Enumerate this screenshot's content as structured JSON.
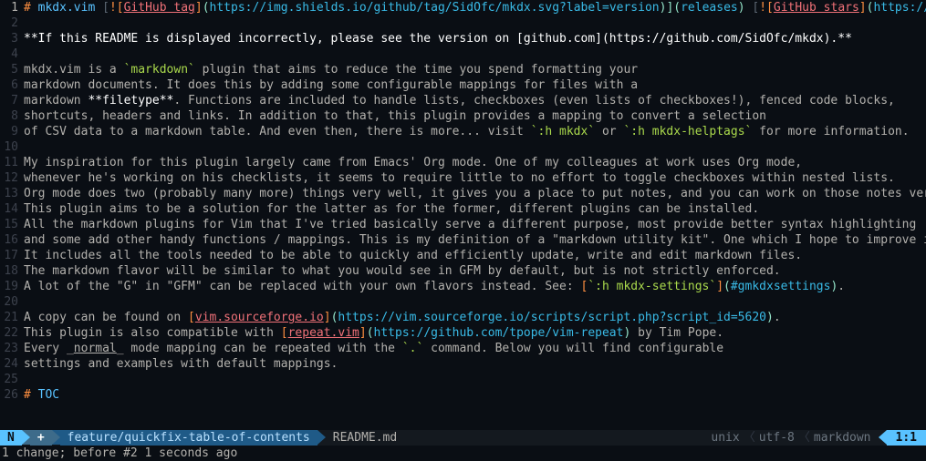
{
  "lines": [
    {
      "n": "1",
      "current": true,
      "segs": [
        {
          "t": "# ",
          "c": "fg-orange"
        },
        {
          "t": "mkdx.vim",
          "c": "fg-blue"
        },
        {
          "t": " [",
          "c": "fg-gray"
        },
        {
          "t": "![",
          "c": "fg-orange"
        },
        {
          "t": "GitHub tag",
          "c": "fg-red underline"
        },
        {
          "t": "]",
          "c": "fg-orange"
        },
        {
          "t": "(",
          "c": "fg-special"
        },
        {
          "t": "https://img.shields.io/github/tag/SidOfc/mkdx.svg?label=version",
          "c": "fg-cyan"
        },
        {
          "t": ")",
          "c": "fg-special"
        },
        {
          "t": "](",
          "c": "fg-special"
        },
        {
          "t": "releases",
          "c": "fg-cyan"
        },
        {
          "t": ")",
          "c": "fg-special"
        },
        {
          "t": " [",
          "c": "fg-gray"
        },
        {
          "t": "![",
          "c": "fg-orange"
        },
        {
          "t": "GitHub stars",
          "c": "fg-red underline"
        },
        {
          "t": "]",
          "c": "fg-orange"
        },
        {
          "t": "(",
          "c": "fg-special"
        },
        {
          "t": "https://img.shields.io/",
          "c": "fg-cyan"
        }
      ]
    },
    {
      "n": "2",
      "segs": []
    },
    {
      "n": "3",
      "segs": [
        {
          "t": "**If this README is displayed incorrectly, please see the version on ",
          "c": "hl"
        },
        {
          "t": "[github.com](https://github.com/SidOfc/mkdx)",
          "c": "hl"
        },
        {
          "t": ".**",
          "c": "hl"
        }
      ]
    },
    {
      "n": "4",
      "segs": []
    },
    {
      "n": "5",
      "segs": [
        {
          "t": "mkdx.vim is a ",
          "c": "fg-text"
        },
        {
          "t": "`markdown`",
          "c": "fg-green"
        },
        {
          "t": " plugin that aims to reduce the time you spend formatting your",
          "c": "fg-text"
        }
      ]
    },
    {
      "n": "6",
      "segs": [
        {
          "t": "markdown documents. It does this by adding some configurable mappings for files with a",
          "c": "fg-text"
        }
      ]
    },
    {
      "n": "7",
      "segs": [
        {
          "t": "markdown ",
          "c": "fg-text"
        },
        {
          "t": "**filetype**",
          "c": "hl"
        },
        {
          "t": ". Functions are included to handle lists, checkboxes (even lists of checkboxes!), fenced code blocks,",
          "c": "fg-text"
        }
      ]
    },
    {
      "n": "8",
      "segs": [
        {
          "t": "shortcuts, headers and links. In addition to that, this plugin provides a mapping to convert a selection",
          "c": "fg-text"
        }
      ]
    },
    {
      "n": "9",
      "segs": [
        {
          "t": "of CSV data to a markdown table. And even then, there is more... visit ",
          "c": "fg-text"
        },
        {
          "t": "`:h mkdx`",
          "c": "fg-green"
        },
        {
          "t": " or ",
          "c": "fg-text"
        },
        {
          "t": "`:h mkdx-helptags`",
          "c": "fg-green"
        },
        {
          "t": " for more information.",
          "c": "fg-text"
        }
      ]
    },
    {
      "n": "10",
      "segs": []
    },
    {
      "n": "11",
      "segs": [
        {
          "t": "My inspiration for this plugin largely came from Emacs' Org mode. One of my colleagues at work uses Org mode,",
          "c": "fg-text"
        }
      ]
    },
    {
      "n": "12",
      "segs": [
        {
          "t": "whenever he's working on his checklists, it seems to require little to no effort to toggle checkboxes within nested lists.",
          "c": "fg-text"
        }
      ]
    },
    {
      "n": "13",
      "segs": [
        {
          "t": "Org mode does two (probably many more) things very well, it gives you a place to put notes, and you can work on those notes very efficiently w",
          "c": "fg-text"
        }
      ]
    },
    {
      "n": "14",
      "segs": [
        {
          "t": "This plugin aims to be a solution for the latter as for the former, different plugins can be installed.",
          "c": "fg-text"
        }
      ]
    },
    {
      "n": "15",
      "segs": [
        {
          "t": "All the markdown plugins for Vim that I've tried basically serve a different purpose, most provide better syntax highlighting",
          "c": "fg-text"
        }
      ]
    },
    {
      "n": "16",
      "segs": [
        {
          "t": "and some add other handy functions / mappings. This is my definition of a \"markdown utility kit\". One which I hope to improve in ways that I c",
          "c": "fg-text"
        }
      ]
    },
    {
      "n": "17",
      "segs": [
        {
          "t": "It includes all the tools needed to be able to quickly and efficiently update, write and edit markdown files.",
          "c": "fg-text"
        }
      ]
    },
    {
      "n": "18",
      "segs": [
        {
          "t": "The markdown flavor will be similar to what you would see in GFM by default, but is not strictly enforced.",
          "c": "fg-text"
        }
      ]
    },
    {
      "n": "19",
      "segs": [
        {
          "t": "A lot of the \"G\" in \"GFM\" can be replaced with your own flavors instead. See: ",
          "c": "fg-text"
        },
        {
          "t": "[",
          "c": "fg-orange"
        },
        {
          "t": "`:h mkdx-settings`",
          "c": "fg-green"
        },
        {
          "t": "]",
          "c": "fg-orange"
        },
        {
          "t": "(",
          "c": "fg-special"
        },
        {
          "t": "#gmkdxsettings",
          "c": "fg-cyan"
        },
        {
          "t": ")",
          "c": "fg-special"
        },
        {
          "t": ".",
          "c": "fg-text"
        }
      ]
    },
    {
      "n": "20",
      "segs": []
    },
    {
      "n": "21",
      "segs": [
        {
          "t": "A copy can be found on ",
          "c": "fg-text"
        },
        {
          "t": "[",
          "c": "fg-orange"
        },
        {
          "t": "vim.sourceforge.io",
          "c": "fg-red underline"
        },
        {
          "t": "]",
          "c": "fg-orange"
        },
        {
          "t": "(",
          "c": "fg-special"
        },
        {
          "t": "https://vim.sourceforge.io/scripts/script.php?script_id=5620",
          "c": "fg-cyan"
        },
        {
          "t": ")",
          "c": "fg-special"
        },
        {
          "t": ".",
          "c": "fg-text"
        }
      ]
    },
    {
      "n": "22",
      "segs": [
        {
          "t": "This plugin is also compatible with ",
          "c": "fg-text"
        },
        {
          "t": "[",
          "c": "fg-orange"
        },
        {
          "t": "repeat.vim",
          "c": "fg-red underline"
        },
        {
          "t": "]",
          "c": "fg-orange"
        },
        {
          "t": "(",
          "c": "fg-special"
        },
        {
          "t": "https://github.com/tpope/vim-repeat",
          "c": "fg-cyan"
        },
        {
          "t": ")",
          "c": "fg-special"
        },
        {
          "t": " by Tim Pope.",
          "c": "fg-text"
        }
      ]
    },
    {
      "n": "23",
      "segs": [
        {
          "t": "Every _",
          "c": "fg-text"
        },
        {
          "t": "normal",
          "c": "fg-text underline"
        },
        {
          "t": "_ mode mapping can be repeated with the ",
          "c": "fg-text"
        },
        {
          "t": "`.`",
          "c": "fg-green"
        },
        {
          "t": " command. Below you will find configurable",
          "c": "fg-text"
        }
      ]
    },
    {
      "n": "24",
      "segs": [
        {
          "t": "settings and examples with default mappings.",
          "c": "fg-text"
        }
      ]
    },
    {
      "n": "25",
      "segs": []
    },
    {
      "n": "26",
      "segs": [
        {
          "t": "# ",
          "c": "fg-orange"
        },
        {
          "t": "TOC",
          "c": "fg-blue"
        }
      ]
    }
  ],
  "status": {
    "mode": "N",
    "add": "+",
    "branch": "feature/quickfix-table-of-contents",
    "file": "README.md",
    "enc_platform": "unix",
    "enc_charset": "utf-8",
    "enc_filetype": "markdown",
    "pos": "1:1"
  },
  "cmdline": "1 change; before #2  1 seconds ago"
}
